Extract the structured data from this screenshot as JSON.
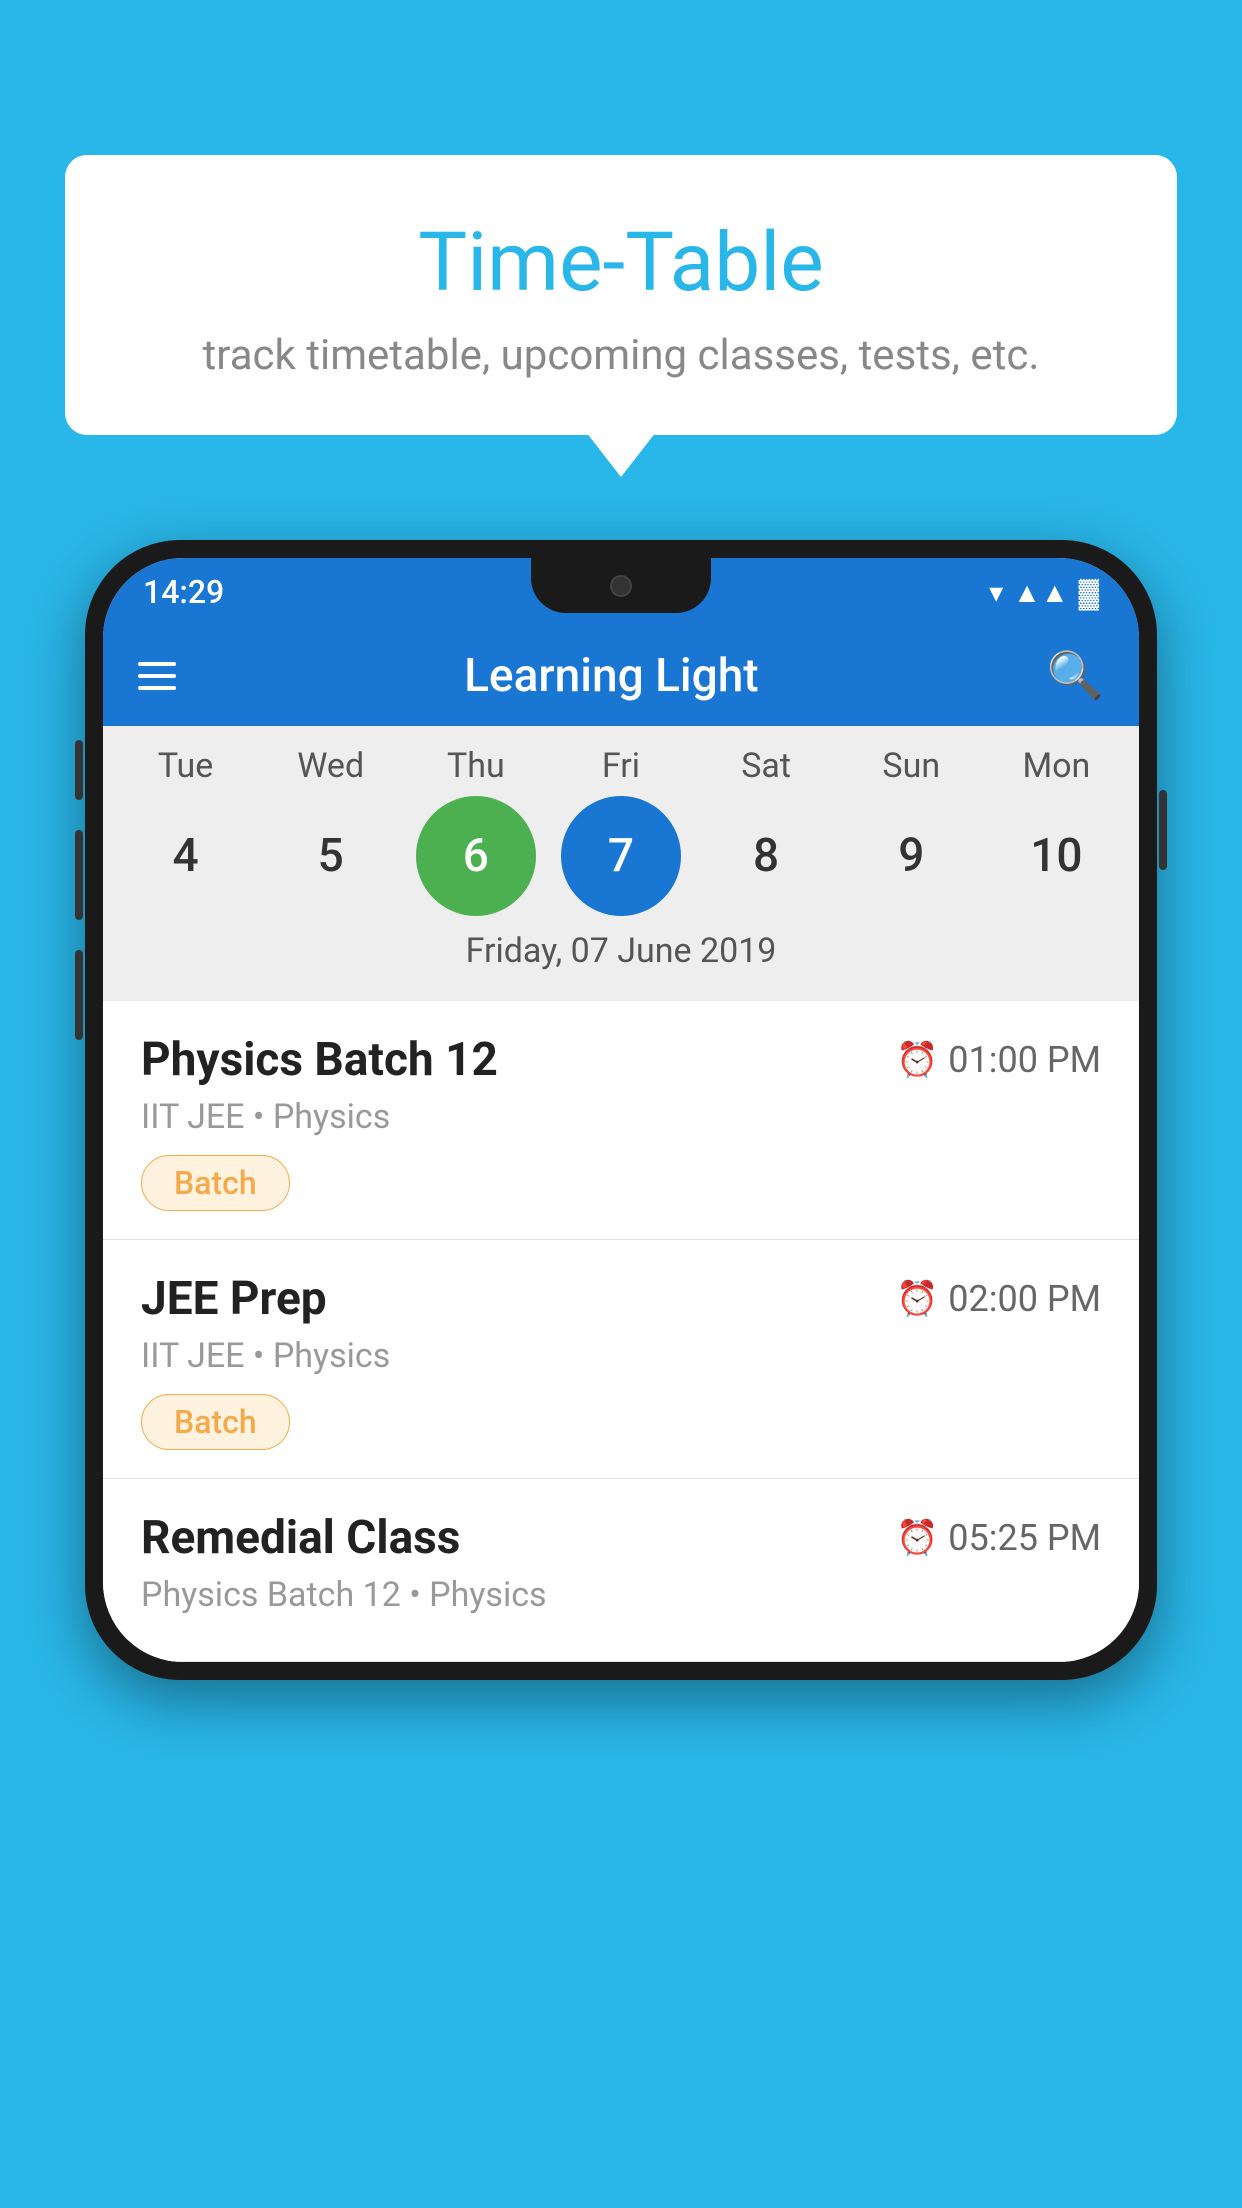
{
  "background_color": "#29b6e8",
  "bubble": {
    "title": "Time-Table",
    "subtitle": "track timetable, upcoming classes, tests, etc."
  },
  "phone": {
    "status_bar": {
      "time": "14:29"
    },
    "app_bar": {
      "title": "Learning Light"
    },
    "calendar": {
      "days": [
        {
          "label": "Tue",
          "num": "4"
        },
        {
          "label": "Wed",
          "num": "5"
        },
        {
          "label": "Thu",
          "num": "6",
          "state": "today"
        },
        {
          "label": "Fri",
          "num": "7",
          "state": "selected"
        },
        {
          "label": "Sat",
          "num": "8"
        },
        {
          "label": "Sun",
          "num": "9"
        },
        {
          "label": "Mon",
          "num": "10"
        }
      ],
      "date_label": "Friday, 07 June 2019"
    },
    "schedule": [
      {
        "title": "Physics Batch 12",
        "time": "01:00 PM",
        "subtitle": "IIT JEE • Physics",
        "tag": "Batch"
      },
      {
        "title": "JEE Prep",
        "time": "02:00 PM",
        "subtitle": "IIT JEE • Physics",
        "tag": "Batch"
      },
      {
        "title": "Remedial Class",
        "time": "05:25 PM",
        "subtitle": "Physics Batch 12 • Physics",
        "tag": ""
      }
    ]
  }
}
